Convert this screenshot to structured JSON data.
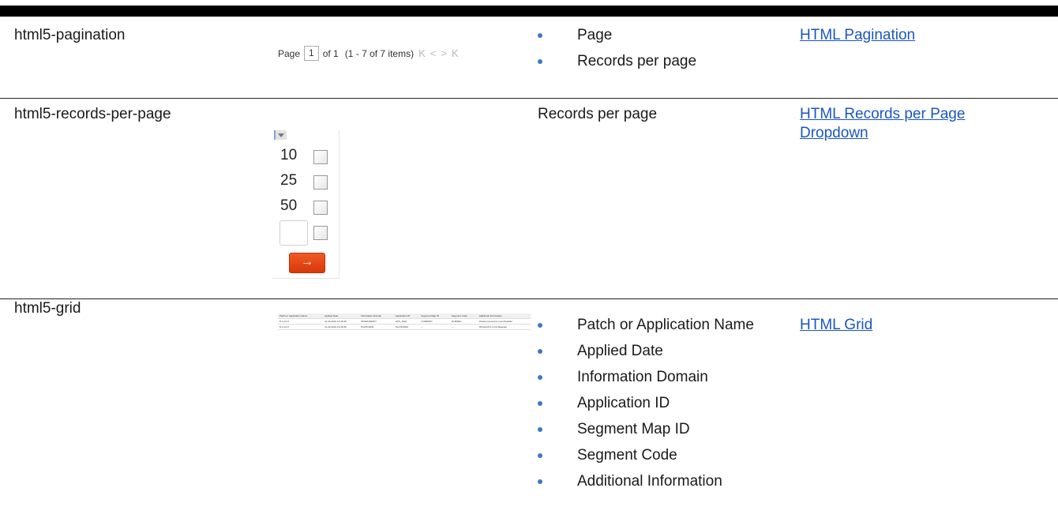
{
  "rows": [
    {
      "name": "html5-pagination",
      "preview": {
        "page_label": "Page",
        "page_value": "1",
        "of_label": "of 1",
        "range_label": "(1 - 7 of  7  items)",
        "first_icon": "K",
        "prev_icon": "<",
        "next_icon": ">",
        "last_icon": "K"
      },
      "items": [
        "Page",
        "Records per page"
      ],
      "link": "HTML Pagination"
    },
    {
      "name": "html5-records-per-page",
      "preview": {
        "options": [
          "10",
          "25",
          "50"
        ],
        "go_icon": "→"
      },
      "text": "Records per page",
      "link_line1": "HTML Records per Page",
      "link_line2": "Dropdown"
    },
    {
      "name": "html5-grid",
      "preview": {
        "columns": [
          "Patch or Application Name",
          "Applied Date",
          "Information Domain",
          "Application ID",
          "Segment Map ID",
          "Segment Code",
          "Additional Information"
        ],
        "rows": [
          [
            "8.1.2.0.0",
            "11-22-2021 10:16:35",
            "OFSDLMINFO",
            "OFS_DLM",
            "COMMON",
            "DLMSEG",
            "Oracle Insurance Loss Modeller"
          ],
          [
            "8.1.2.0.0",
            "11-22-2021 10:16:45",
            "PLATFORM",
            "PLATFORM",
            "--",
            "--",
            "OFSAAI 8.1.2.0.0 Release"
          ]
        ]
      },
      "items": [
        "Patch or Application Name",
        "Applied Date",
        "Information Domain",
        "Application ID",
        "Segment Map ID",
        "Segment Code",
        "Additional Information"
      ],
      "link": "HTML Grid"
    }
  ]
}
